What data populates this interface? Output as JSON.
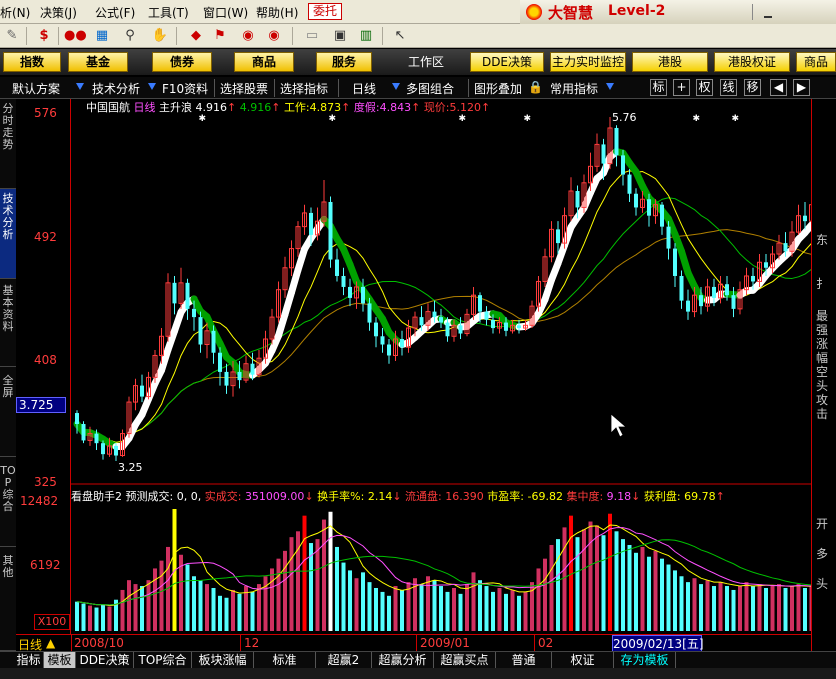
{
  "menu": {
    "items": [
      "析(N)",
      "决策(J)",
      "公式(F)",
      "工具(T)",
      "窗口(W)",
      "帮助(H)"
    ],
    "weituo": "委托",
    "brand": "大智慧",
    "level": "Level-2"
  },
  "modules": {
    "items": [
      "指数",
      "基金",
      "债券",
      "商品",
      "服务"
    ],
    "workspace": "工作区",
    "right": [
      "DDE决策",
      "主力实时监控",
      "港股",
      "港股权证",
      "商品"
    ]
  },
  "subbar": {
    "items": [
      "默认方案",
      "技术分析",
      "F10资料",
      "选择股票",
      "选择指标",
      "日线",
      "多图组合",
      "图形叠加",
      "常用指标"
    ],
    "buttons": [
      "标",
      "+",
      "权",
      "线",
      "移",
      "◀",
      "▶"
    ]
  },
  "sidetabs": [
    "分时走势",
    "技术分析",
    "基本资料",
    "全屏",
    "TOP综合",
    "其他"
  ],
  "axis": {
    "labels": [
      "576",
      "492",
      "408",
      "325"
    ],
    "vol_labels": [
      "12482",
      "6192"
    ],
    "current": "3.725",
    "scale": "X100"
  },
  "info": {
    "stock": "中国国航",
    "period": "日线",
    "ind": "主升浪",
    "ind_val": "4.916",
    "v1": "4.916",
    "work_label": "工作:",
    "work": "4.873",
    "dj_label": "度假:",
    "dj": "4.843",
    "xj_label": "现价:",
    "xj": "5.120"
  },
  "vol": {
    "name": "看盘助手2",
    "yc_label": "预测成交:",
    "yc": "0, 0,",
    "sc_label": "实成交:",
    "sc": "351009.00",
    "hs_label": "换手率%:",
    "hs": "2.14",
    "lt_label": "流通盘:",
    "lt": "16.390",
    "sy_label": "市盈率:",
    "sy": "-69.82",
    "jz_label": "集中度:",
    "jz": "9.18",
    "hl_label": "获利盘:",
    "hl": "69.78"
  },
  "annot": {
    "high": "5.76",
    "low": "3.25"
  },
  "right_panel": {
    "top": "东",
    "mid": "扌",
    "lower": "最强涨幅空头攻击",
    "t1": "开",
    "t2": "多",
    "t3": "头"
  },
  "timeline": {
    "label": "日线",
    "dates": [
      "2008/10",
      "12",
      "2009/01",
      "02"
    ],
    "current": "2009/02/13[五]"
  },
  "bottomtabs": [
    "指标",
    "模板",
    "DDE决策",
    "TOP综合",
    "板块涨幅",
    "标准",
    "超赢2",
    "超赢分析",
    "超赢买点",
    "普通",
    "权证",
    "存为模板"
  ],
  "colors": {
    "up": "#ff3c3c",
    "down": "#54ffff",
    "accent": "#ffd000",
    "green_line": "#00a000",
    "yellow": "#ffff00",
    "purple": "#ff50ff"
  },
  "chart_data": {
    "type": "candlestick",
    "ylim": [
      3.25,
      5.76
    ],
    "yticks": [
      3.25,
      4.08,
      4.92,
      5.76
    ],
    "candles": [
      [
        3.6,
        3.52,
        3.62,
        3.45
      ],
      [
        3.52,
        3.4,
        3.54,
        3.38
      ],
      [
        3.4,
        3.45,
        3.5,
        3.36
      ],
      [
        3.45,
        3.38,
        3.48,
        3.33
      ],
      [
        3.38,
        3.3,
        3.4,
        3.26
      ],
      [
        3.3,
        3.36,
        3.42,
        3.28
      ],
      [
        3.36,
        3.29,
        3.38,
        3.25
      ],
      [
        3.29,
        3.45,
        3.48,
        3.28
      ],
      [
        3.45,
        3.68,
        3.72,
        3.42
      ],
      [
        3.68,
        3.8,
        3.85,
        3.62
      ],
      [
        3.8,
        3.72,
        3.88,
        3.68
      ],
      [
        3.72,
        3.86,
        3.9,
        3.7
      ],
      [
        3.86,
        4.02,
        4.06,
        3.82
      ],
      [
        4.02,
        4.16,
        4.22,
        3.96
      ],
      [
        4.16,
        4.55,
        4.62,
        4.12
      ],
      [
        4.55,
        4.4,
        4.6,
        4.32
      ],
      [
        4.4,
        4.55,
        4.66,
        4.36
      ],
      [
        4.55,
        4.36,
        4.58,
        4.28
      ],
      [
        4.36,
        4.3,
        4.42,
        4.2
      ],
      [
        4.3,
        4.1,
        4.34,
        4.04
      ],
      [
        4.1,
        4.2,
        4.26,
        4.0
      ],
      [
        4.2,
        4.04,
        4.24,
        3.96
      ],
      [
        4.04,
        3.9,
        4.08,
        3.8
      ],
      [
        3.9,
        3.8,
        3.96,
        3.74
      ],
      [
        3.8,
        3.9,
        3.98,
        3.72
      ],
      [
        3.9,
        3.84,
        3.98,
        3.78
      ],
      [
        3.84,
        3.96,
        4.02,
        3.82
      ],
      [
        3.96,
        3.88,
        4.04,
        3.84
      ],
      [
        3.88,
        4.0,
        4.06,
        3.86
      ],
      [
        4.0,
        4.14,
        4.2,
        3.96
      ],
      [
        4.14,
        4.3,
        4.36,
        4.1
      ],
      [
        4.3,
        4.5,
        4.56,
        4.26
      ],
      [
        4.5,
        4.66,
        4.74,
        4.44
      ],
      [
        4.66,
        4.8,
        4.86,
        4.6
      ],
      [
        4.8,
        4.96,
        5.0,
        4.74
      ],
      [
        4.96,
        5.06,
        5.12,
        4.9
      ],
      [
        5.06,
        4.9,
        5.1,
        4.82
      ],
      [
        4.9,
        5.0,
        5.1,
        4.86
      ],
      [
        5.0,
        5.14,
        5.3,
        4.96
      ],
      [
        5.14,
        4.72,
        5.18,
        4.66
      ],
      [
        4.72,
        4.6,
        4.8,
        4.56
      ],
      [
        4.6,
        4.52,
        4.66,
        4.46
      ],
      [
        4.52,
        4.44,
        4.58,
        4.38
      ],
      [
        4.44,
        4.52,
        4.56,
        4.36
      ],
      [
        4.52,
        4.4,
        4.58,
        4.34
      ],
      [
        4.4,
        4.26,
        4.44,
        4.2
      ],
      [
        4.26,
        4.16,
        4.3,
        4.08
      ],
      [
        4.16,
        4.1,
        4.22,
        4.04
      ],
      [
        4.1,
        4.02,
        4.14,
        3.96
      ],
      [
        4.02,
        4.14,
        4.2,
        3.98
      ],
      [
        4.14,
        4.08,
        4.2,
        4.02
      ],
      [
        4.08,
        4.22,
        4.28,
        4.04
      ],
      [
        4.22,
        4.3,
        4.34,
        4.16
      ],
      [
        4.3,
        4.24,
        4.38,
        4.2
      ],
      [
        4.24,
        4.34,
        4.4,
        4.2
      ],
      [
        4.34,
        4.3,
        4.42,
        4.26
      ],
      [
        4.3,
        4.26,
        4.36,
        4.22
      ],
      [
        4.26,
        4.16,
        4.3,
        4.12
      ],
      [
        4.16,
        4.24,
        4.28,
        4.12
      ],
      [
        4.24,
        4.18,
        4.3,
        4.14
      ],
      [
        4.18,
        4.32,
        4.36,
        4.16
      ],
      [
        4.32,
        4.46,
        4.52,
        4.28
      ],
      [
        4.46,
        4.34,
        4.48,
        4.26
      ],
      [
        4.34,
        4.28,
        4.38,
        4.24
      ],
      [
        4.28,
        4.22,
        4.32,
        4.18
      ],
      [
        4.22,
        4.26,
        4.3,
        4.18
      ],
      [
        4.26,
        4.2,
        4.3,
        4.16
      ],
      [
        4.2,
        4.24,
        4.28,
        4.18
      ],
      [
        4.24,
        4.22,
        4.28,
        4.18
      ],
      [
        4.22,
        4.24,
        4.28,
        4.2
      ],
      [
        4.24,
        4.38,
        4.42,
        4.22
      ],
      [
        4.38,
        4.56,
        4.6,
        4.34
      ],
      [
        4.56,
        4.74,
        4.8,
        4.52
      ],
      [
        4.74,
        4.94,
        5.0,
        4.7
      ],
      [
        4.94,
        4.84,
        5.0,
        4.76
      ],
      [
        4.84,
        5.04,
        5.1,
        4.8
      ],
      [
        5.04,
        5.22,
        5.32,
        5.0
      ],
      [
        5.22,
        5.1,
        5.26,
        5.02
      ],
      [
        5.1,
        5.28,
        5.34,
        5.06
      ],
      [
        5.28,
        5.4,
        5.5,
        5.22
      ],
      [
        5.4,
        5.56,
        5.64,
        5.36
      ],
      [
        5.56,
        5.42,
        5.6,
        5.3
      ],
      [
        5.42,
        5.68,
        5.76,
        5.38
      ],
      [
        5.68,
        5.48,
        5.7,
        5.4
      ],
      [
        5.48,
        5.34,
        5.52,
        5.26
      ],
      [
        5.34,
        5.2,
        5.38,
        5.14
      ],
      [
        5.2,
        5.1,
        5.24,
        5.04
      ],
      [
        5.1,
        5.16,
        5.22,
        5.06
      ],
      [
        5.16,
        5.04,
        5.2,
        4.96
      ],
      [
        5.04,
        5.12,
        5.16,
        4.98
      ],
      [
        5.12,
        4.96,
        5.14,
        4.9
      ],
      [
        4.96,
        4.8,
        5.0,
        4.72
      ],
      [
        4.8,
        4.6,
        4.84,
        4.52
      ],
      [
        4.6,
        4.42,
        4.64,
        4.36
      ],
      [
        4.42,
        4.34,
        4.5,
        4.28
      ],
      [
        4.34,
        4.46,
        4.52,
        4.3
      ],
      [
        4.46,
        4.38,
        4.52,
        4.32
      ],
      [
        4.38,
        4.52,
        4.58,
        4.34
      ],
      [
        4.52,
        4.44,
        4.58,
        4.38
      ],
      [
        4.44,
        4.54,
        4.6,
        4.4
      ],
      [
        4.54,
        4.46,
        4.6,
        4.42
      ],
      [
        4.46,
        4.36,
        4.52,
        4.3
      ],
      [
        4.36,
        4.5,
        4.56,
        4.32
      ],
      [
        4.5,
        4.6,
        4.66,
        4.46
      ],
      [
        4.6,
        4.56,
        4.66,
        4.5
      ],
      [
        4.56,
        4.7,
        4.76,
        4.52
      ],
      [
        4.7,
        4.66,
        4.76,
        4.6
      ],
      [
        4.66,
        4.76,
        4.82,
        4.62
      ],
      [
        4.76,
        4.84,
        4.9,
        4.72
      ],
      [
        4.84,
        4.78,
        4.92,
        4.74
      ],
      [
        4.78,
        4.92,
        5.0,
        4.74
      ],
      [
        4.92,
        5.04,
        5.12,
        4.9
      ],
      [
        5.04,
        5.0,
        5.14,
        4.94
      ],
      [
        5.0,
        5.12,
        5.2,
        4.96
      ]
    ],
    "volume": [
      3000,
      2800,
      2600,
      2400,
      2700,
      2500,
      3200,
      4200,
      5200,
      4800,
      4600,
      5200,
      6400,
      7200,
      8600,
      12482,
      7800,
      6800,
      5600,
      5200,
      4800,
      4400,
      3600,
      3400,
      4200,
      3800,
      4600,
      4000,
      4800,
      5600,
      6400,
      7400,
      8200,
      9600,
      10200,
      11800,
      9000,
      9400,
      11400,
      12200,
      8600,
      7000,
      6200,
      5400,
      6000,
      5000,
      4400,
      4000,
      3600,
      4600,
      4200,
      5000,
      5400,
      4800,
      5600,
      5200,
      4600,
      4000,
      4400,
      3800,
      4800,
      6000,
      5200,
      4600,
      4000,
      4400,
      3800,
      4200,
      3600,
      4000,
      5000,
      6400,
      7400,
      8800,
      9400,
      10600,
      11800,
      9600,
      10400,
      11200,
      10800,
      9800,
      12000,
      10200,
      9400,
      8800,
      8000,
      8600,
      7600,
      8200,
      7400,
      6800,
      6200,
      5600,
      5000,
      5400,
      4800,
      5200,
      4600,
      5000,
      4600,
      4200,
      4600,
      5000,
      4600,
      4800,
      4400,
      4600,
      4800,
      4400,
      4600,
      4800,
      4400,
      4600
    ]
  }
}
